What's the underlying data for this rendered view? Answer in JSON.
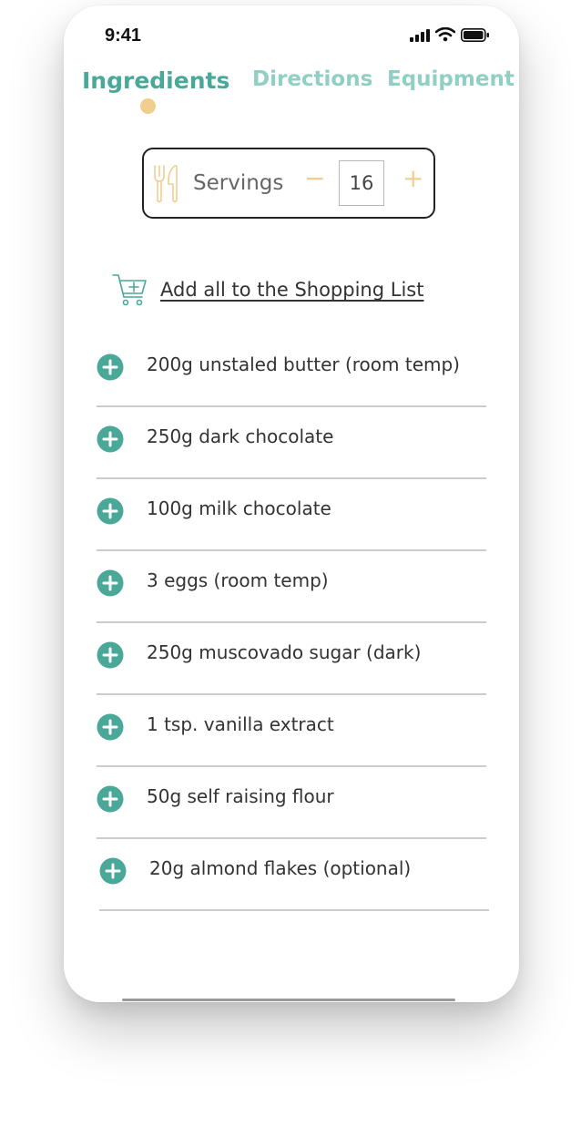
{
  "status_bar": {
    "time": "9:41"
  },
  "tabs": [
    {
      "label": "Ingredients",
      "active": true
    },
    {
      "label": "Directions",
      "active": false
    },
    {
      "label": "Equipment",
      "active": false
    }
  ],
  "servings": {
    "label": "Servings",
    "minus": "−",
    "value": "16",
    "plus": "+"
  },
  "shopping": {
    "label": "Add all to the Shopping List"
  },
  "ingredients": [
    "200g unstaled butter (room temp)",
    "250g dark chocolate",
    "100g milk chocolate",
    "3 eggs (room temp)",
    "250g muscovado sugar (dark)",
    "1 tsp. vanilla extract",
    "50g self raising flour",
    "20g almond flakes (optional)"
  ],
  "colors": {
    "accent": "#4aa898",
    "tab_inactive": "#8fcfc4",
    "highlight": "#f1cd8e",
    "divider": "#cccccc"
  },
  "icons": {
    "utensils": "utensils-icon",
    "cart": "cart-add-icon",
    "add": "plus-circle-icon"
  }
}
